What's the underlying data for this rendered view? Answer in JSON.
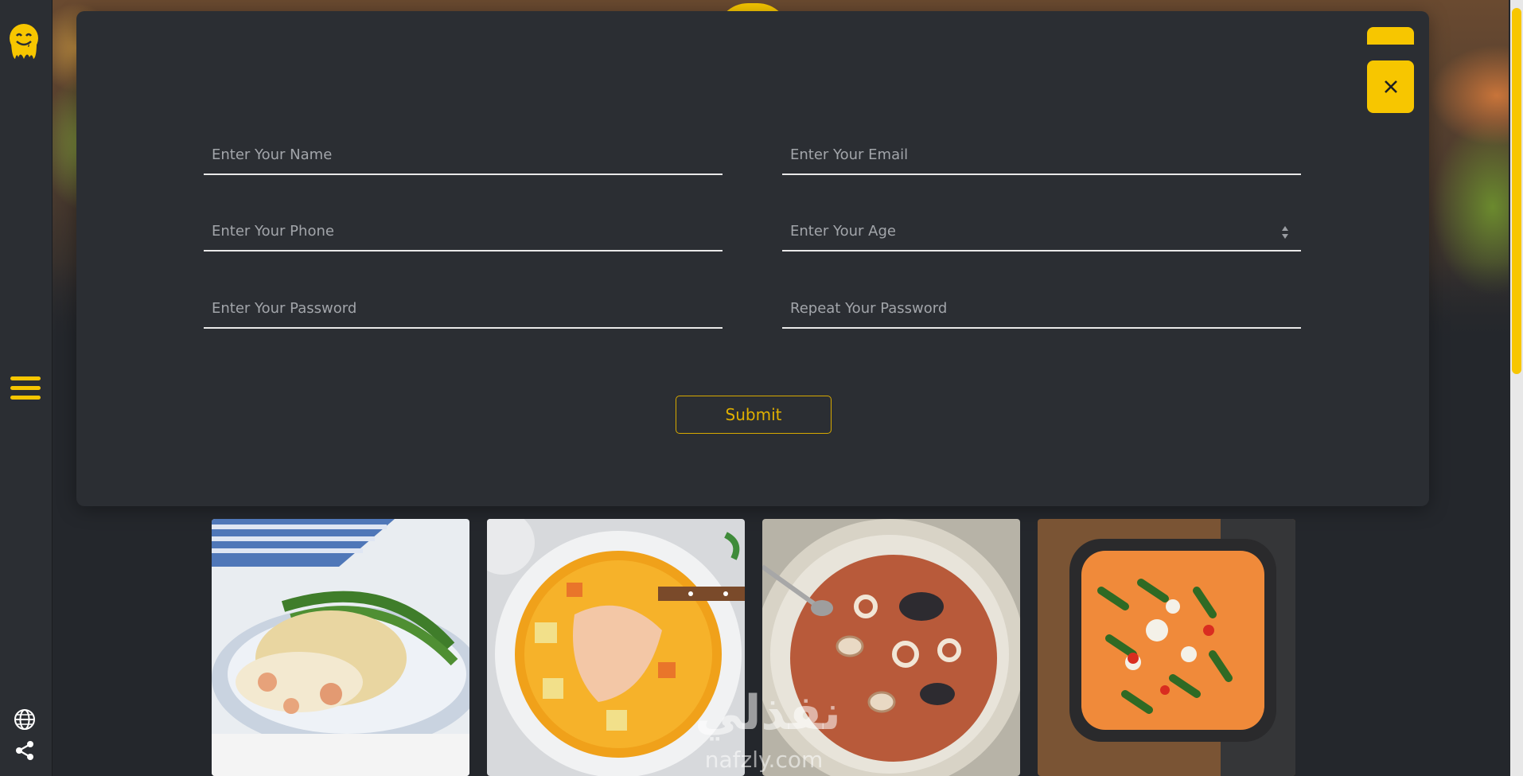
{
  "form": {
    "name_placeholder": "Enter Your Name",
    "email_placeholder": "Enter Your Email",
    "phone_placeholder": "Enter Your Phone",
    "age_placeholder": "Enter Your Age",
    "password_placeholder": "Enter Your Password",
    "repeat_password_placeholder": "Repeat Your Password",
    "submit_label": "Submit"
  },
  "close_icon": "close-icon",
  "watermark": {
    "arabic": "نفذلي",
    "domain": "nafzly.com"
  },
  "colors": {
    "accent": "#f7c600",
    "modal_bg": "#2b2e33",
    "page_bg": "#24272c",
    "input_line": "#e9e9e9",
    "placeholder": "#a2a5aa"
  },
  "cards": [
    {
      "dish": "fish-pie"
    },
    {
      "dish": "salmon-soup"
    },
    {
      "dish": "seafood-stew"
    },
    {
      "dish": "baked-shakshuka"
    }
  ]
}
